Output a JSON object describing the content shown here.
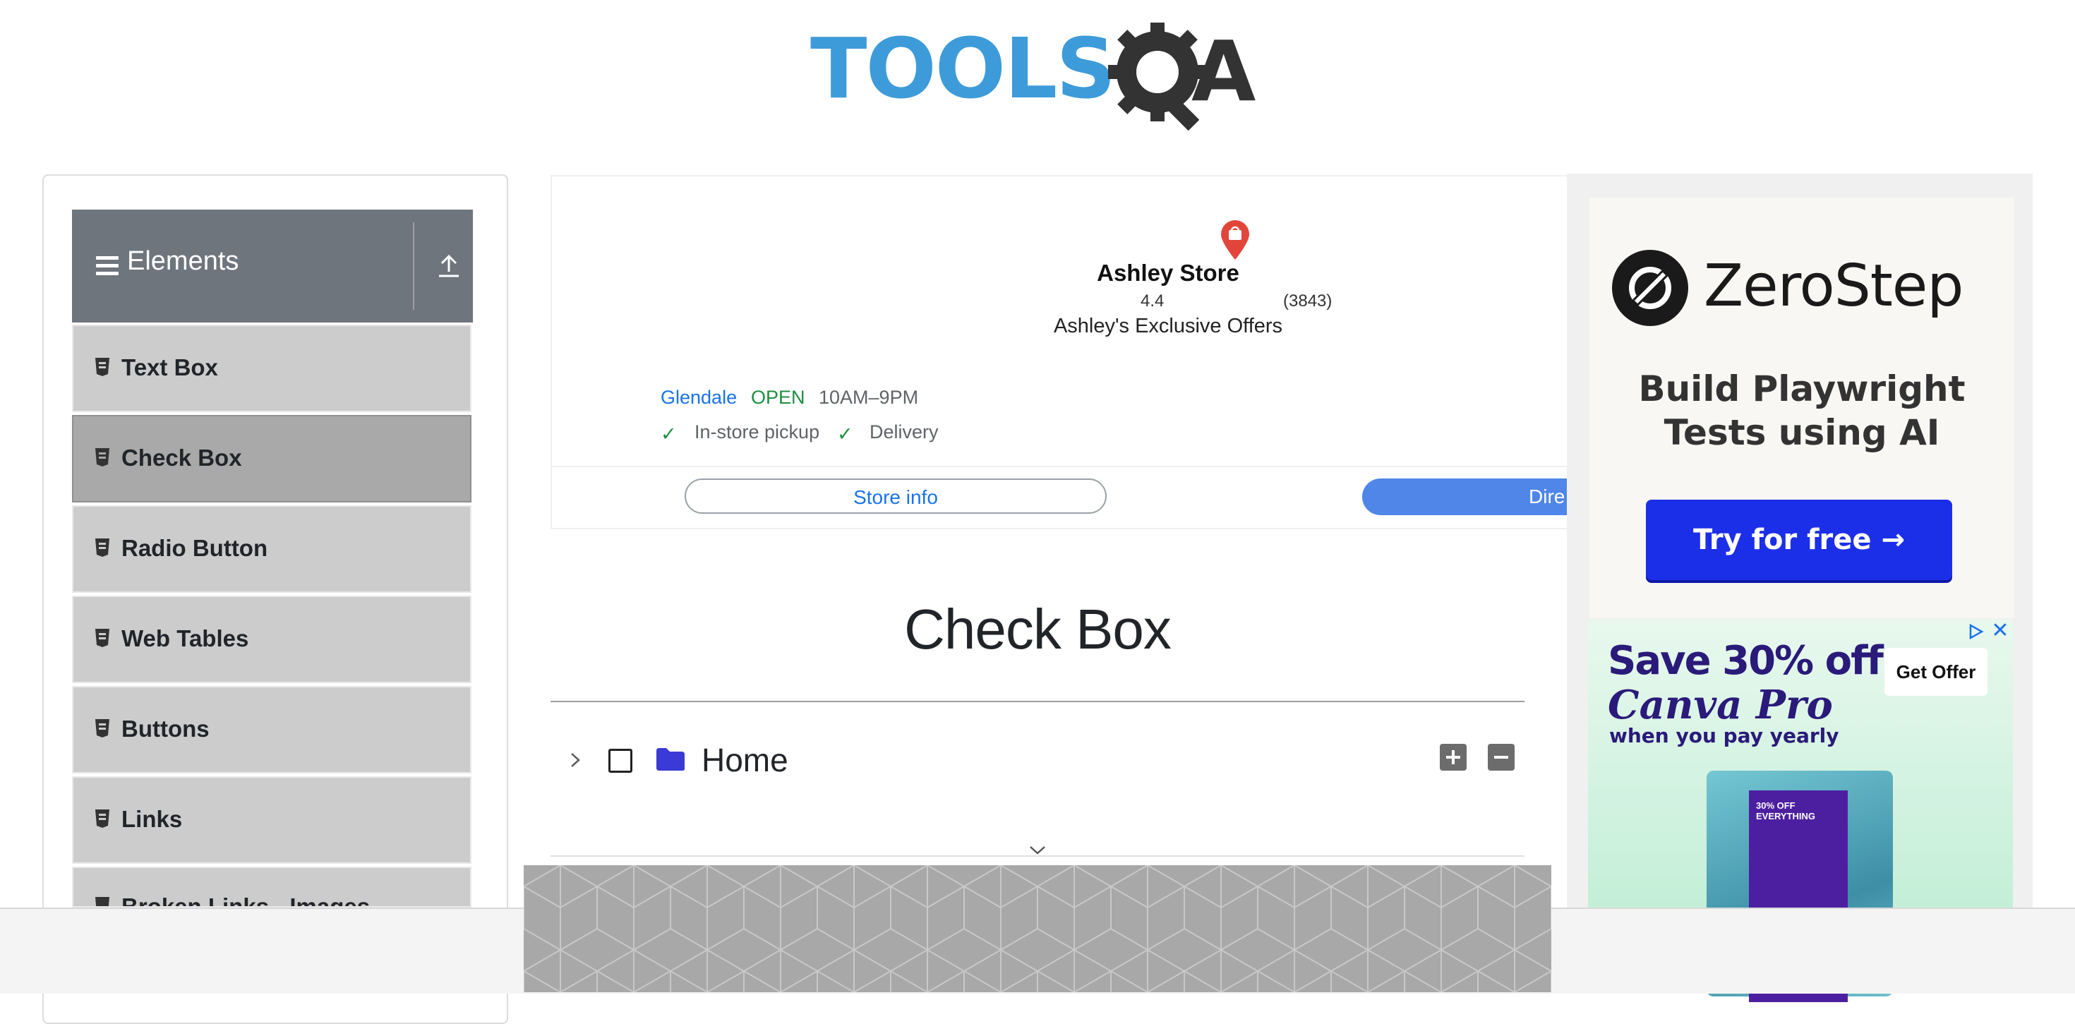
{
  "header": {
    "logo_text": "TOOLS",
    "logo_tail": "A"
  },
  "sidebar": {
    "group_title": "Elements",
    "items": [
      {
        "label": "Text Box",
        "active": false
      },
      {
        "label": "Check Box",
        "active": true
      },
      {
        "label": "Radio Button",
        "active": false
      },
      {
        "label": "Web Tables",
        "active": false
      },
      {
        "label": "Buttons",
        "active": false
      },
      {
        "label": "Links",
        "active": false
      },
      {
        "label": "Broken Links - Images",
        "active": false
      }
    ]
  },
  "store_ad": {
    "name": "Ashley Store",
    "rating": "4.4",
    "reviews": "(3843)",
    "offers": "Ashley's Exclusive Offers",
    "city": "Glendale",
    "status": "OPEN",
    "hours": "10AM–9PM",
    "pickup": "In-store pickup",
    "delivery": "Delivery",
    "store_info_label": "Store info",
    "directions_label": "Dire",
    "check_glyph": "✓"
  },
  "main": {
    "title": "Check Box",
    "tree": {
      "root_label": "Home",
      "checked": false
    }
  },
  "zerostep_ad": {
    "brand": "ZeroStep",
    "tagline": "Build Playwright Tests using AI",
    "cta": "Try for free →"
  },
  "canva_ad": {
    "headline": "Save 30% off",
    "brand": "Canva Pro",
    "subline": "when you pay yearly",
    "cta": "Get Offer",
    "close_glyph": "✕",
    "poster_text": "30% OFF EVERYTHING"
  },
  "colors": {
    "sidebar_header": "#6f757d",
    "menu_item": "#cccccc",
    "menu_item_active": "#a9a9a9",
    "logo_blue": "#3d9bd9",
    "link_blue": "#1a73e8",
    "open_green": "#1e8e3e",
    "zerostep_cta": "#1c2fe8",
    "canva_text": "#2a1a7a"
  },
  "icons": {
    "menu": "hamburger-icon",
    "collapse": "upload-arrow-icon",
    "item": "html5-doc-icon",
    "map_pin": "map-pin-icon",
    "tree_toggle": "chevron-right-icon",
    "folder": "folder-icon",
    "expand_all": "plus-square-icon",
    "collapse_all": "minus-square-icon"
  }
}
